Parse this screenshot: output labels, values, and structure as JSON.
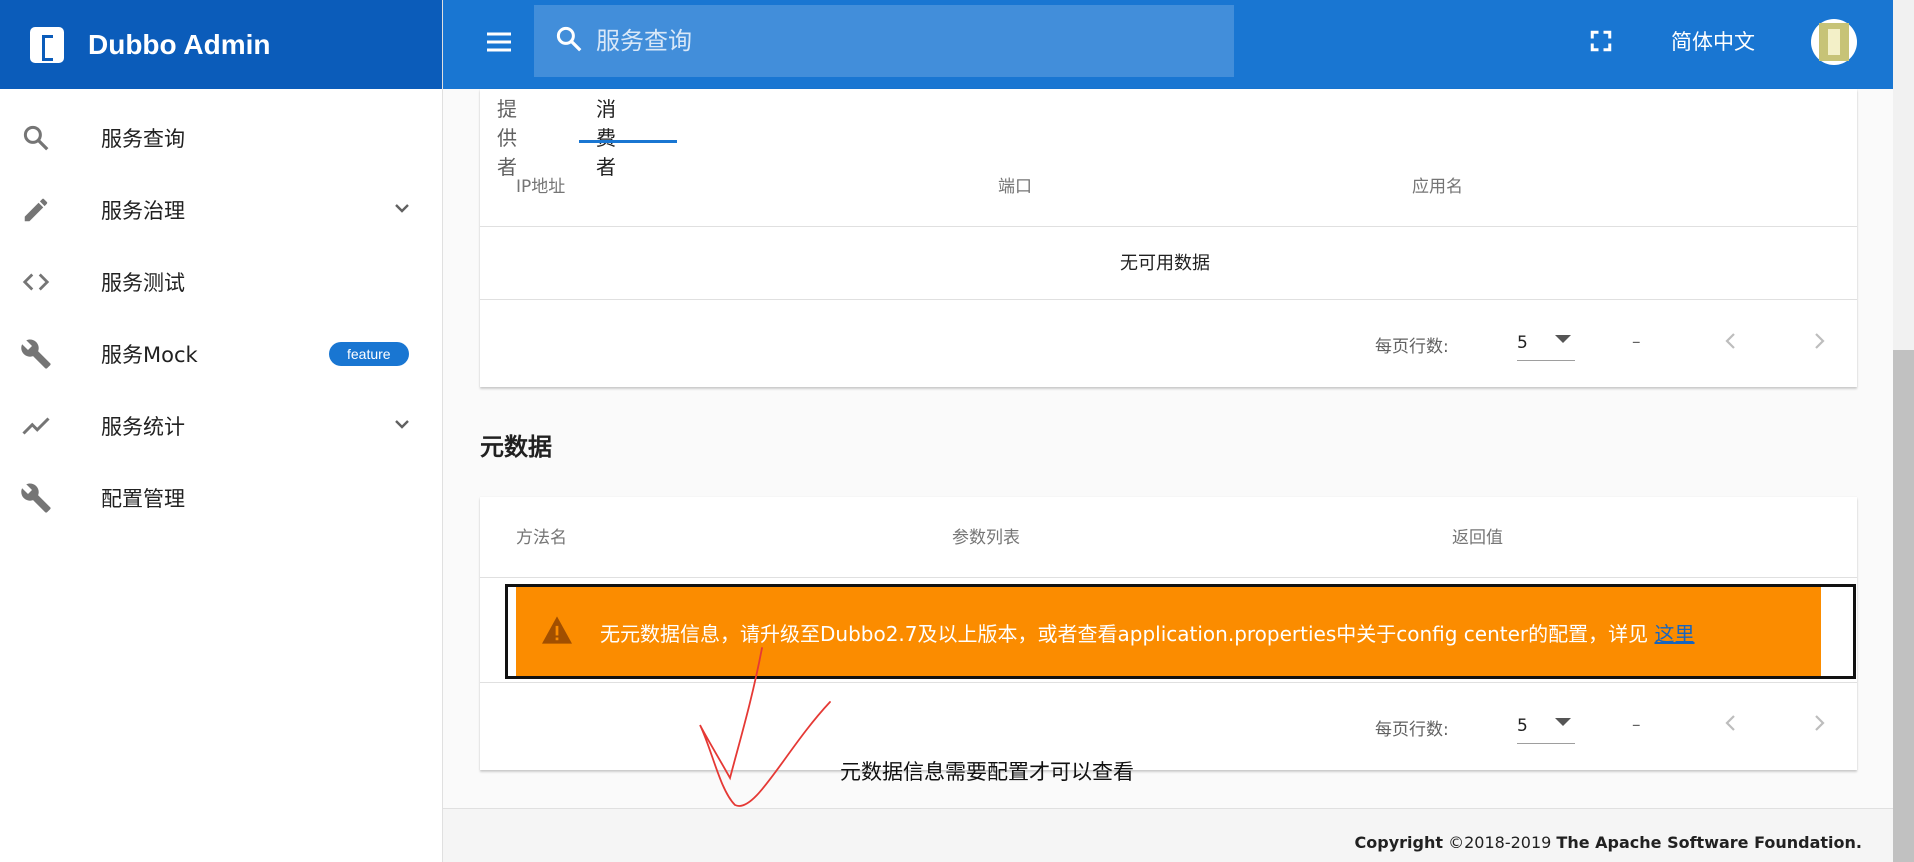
{
  "app": {
    "title": "Dubbo Admin"
  },
  "sidebar": {
    "items": [
      {
        "label": "服务查询",
        "icon": "search-icon"
      },
      {
        "label": "服务治理",
        "icon": "pencil-icon",
        "expandable": true
      },
      {
        "label": "服务测试",
        "icon": "code-icon"
      },
      {
        "label": "服务Mock",
        "icon": "wrench-icon",
        "badge": "feature"
      },
      {
        "label": "服务统计",
        "icon": "chart-line-icon",
        "expandable": true
      },
      {
        "label": "配置管理",
        "icon": "wrench-icon"
      }
    ]
  },
  "topbar": {
    "search_placeholder": "服务查询",
    "language": "简体中文"
  },
  "tabs": [
    {
      "label": "提供者",
      "active": false
    },
    {
      "label": "消费者",
      "active": true
    }
  ],
  "consumer_table": {
    "headers": [
      "IP地址",
      "端口",
      "应用名"
    ],
    "empty_text": "无可用数据",
    "rows_per_page_label": "每页行数:",
    "rows_per_page_value": "5",
    "range": "–"
  },
  "metadata": {
    "title": "元数据",
    "headers": [
      "方法名",
      "参数列表",
      "返回值"
    ],
    "alert_text": "无元数据信息，请升级至Dubbo2.7及以上版本，或者查看application.properties中关于config center的配置，详见 ",
    "alert_link": "这里",
    "rows_per_page_label": "每页行数:",
    "rows_per_page_value": "5",
    "range": "–"
  },
  "annotation": "元数据信息需要配置才可以查看",
  "footer": {
    "copyright_label": "Copyright",
    "years": "©2018-2019",
    "org": "The Apache Software Foundation."
  },
  "colors": {
    "primary": "#1976d2",
    "sidebar_header": "#0b5cba",
    "alert": "#fb8c00",
    "annotation_arrow": "#e53935"
  }
}
